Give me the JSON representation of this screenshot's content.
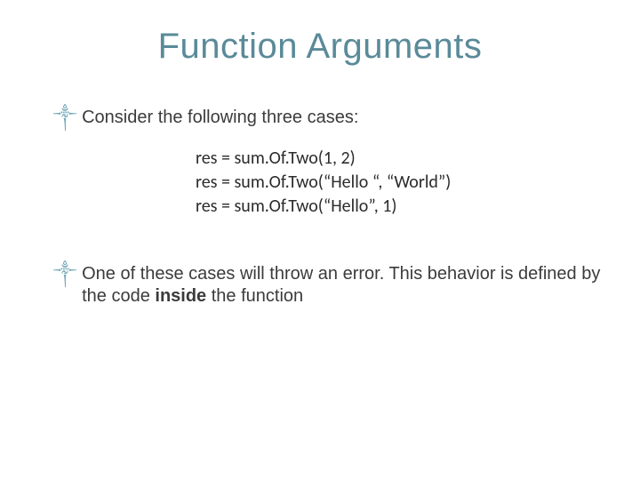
{
  "title": "Function Arguments",
  "bullets": {
    "b1": "Consider the following three cases:",
    "b2_pre": "One of these cases will throw an error. This behavior is defined by the code ",
    "b2_bold": "inside",
    "b2_post": " the function"
  },
  "code": {
    "l1": "res = sum.Of.Two(1, 2)",
    "l2": "res = sum.Of.Two(“Hello “, “World”)",
    "l3": "res = sum.Of.Two(“Hello”, 1)"
  },
  "glyph": "༒"
}
